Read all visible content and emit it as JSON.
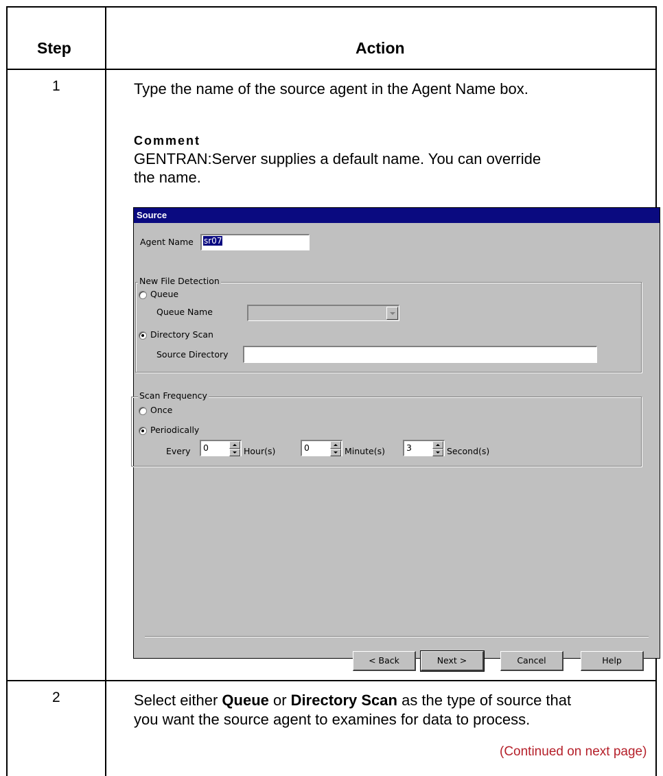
{
  "table": {
    "header_step": "Step",
    "header_action": "Action",
    "rows": [
      {
        "step": "1",
        "instruction": "Type the name of the source agent in the Agent Name box.",
        "comment_title": "Comment",
        "comment_line1": "GENTRAN:Server supplies a default name. You can override",
        "comment_line2": "the name."
      },
      {
        "step": "2",
        "pre1": "Select either ",
        "kw1": "Queue",
        "mid": " or ",
        "kw2": "Directory Scan",
        "post": " as the type of source that",
        "line2": "you want the source agent to examines for data to process."
      }
    ],
    "continued": "(Continued on next page)"
  },
  "dialog": {
    "title": "Source",
    "agent_name_label": "Agent Name",
    "agent_name_value": "sr07",
    "new_file_detection": {
      "legend": "New File Detection",
      "queue_label": "Queue",
      "queue_selected": false,
      "queue_name_label": "Queue Name",
      "queue_name_value": "",
      "directory_scan_label": "Directory Scan",
      "directory_scan_selected": true,
      "source_directory_label": "Source Directory",
      "source_directory_value": ""
    },
    "scan_frequency": {
      "legend": "Scan Frequency",
      "once_label": "Once",
      "once_selected": false,
      "periodically_label": "Periodically",
      "periodically_selected": true,
      "every_label": "Every",
      "hours_value": "0",
      "hours_label": "Hour(s)",
      "minutes_value": "0",
      "minutes_label": "Minute(s)",
      "seconds_value": "3",
      "seconds_label": "Second(s)"
    },
    "buttons": {
      "back": "< Back",
      "next": "Next >",
      "cancel": "Cancel",
      "help": "Help"
    }
  }
}
